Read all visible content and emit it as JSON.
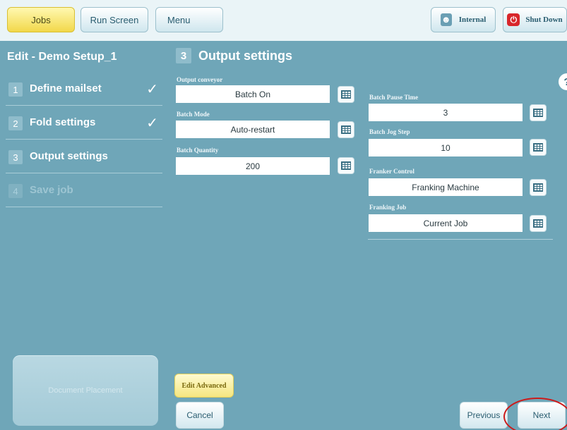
{
  "topbar": {
    "jobs": "Jobs",
    "run_screen": "Run Screen",
    "menu": "Menu",
    "internal": "Internal",
    "shut_down": "Shut Down"
  },
  "sidebar": {
    "title": "Edit - Demo Setup_1",
    "items": [
      {
        "num": "1",
        "label": "Define mailset",
        "state": "done"
      },
      {
        "num": "2",
        "label": "Fold settings",
        "state": "done"
      },
      {
        "num": "3",
        "label": "Output settings",
        "state": "current"
      },
      {
        "num": "4",
        "label": "Save job",
        "state": "disabled"
      }
    ],
    "check_glyph": "✓",
    "document_placement": "Document Placement"
  },
  "main": {
    "step_num": "3",
    "title": "Output settings",
    "help": "?",
    "left_fields": [
      {
        "label": "Output conveyor",
        "value": "Batch On"
      },
      {
        "label": "Batch Mode",
        "value": "Auto-restart"
      },
      {
        "label": "Batch Quantity",
        "value": "200"
      }
    ],
    "right_fields": [
      {
        "label": "Batch Pause Time",
        "value": "3"
      },
      {
        "label": "Batch Jog Step",
        "value": "10"
      },
      {
        "label": "Franker Control",
        "value": "Franking Machine"
      },
      {
        "label": "Franking Job",
        "value": "Current Job"
      }
    ],
    "edit_advanced": "Edit Advanced",
    "cancel": "Cancel",
    "previous": "Previous",
    "next": "Next"
  },
  "colors": {
    "background": "#6fa6b8",
    "topbar": "#eaf4f7",
    "active_tab": "#f2d84a",
    "shutdown_icon": "#d8262b",
    "highlight_ring": "#cc1b1b"
  },
  "icons": {
    "user": "user-icon",
    "power": "power-icon",
    "keypad": "keypad-icon",
    "check": "check-icon",
    "help": "help-icon"
  }
}
